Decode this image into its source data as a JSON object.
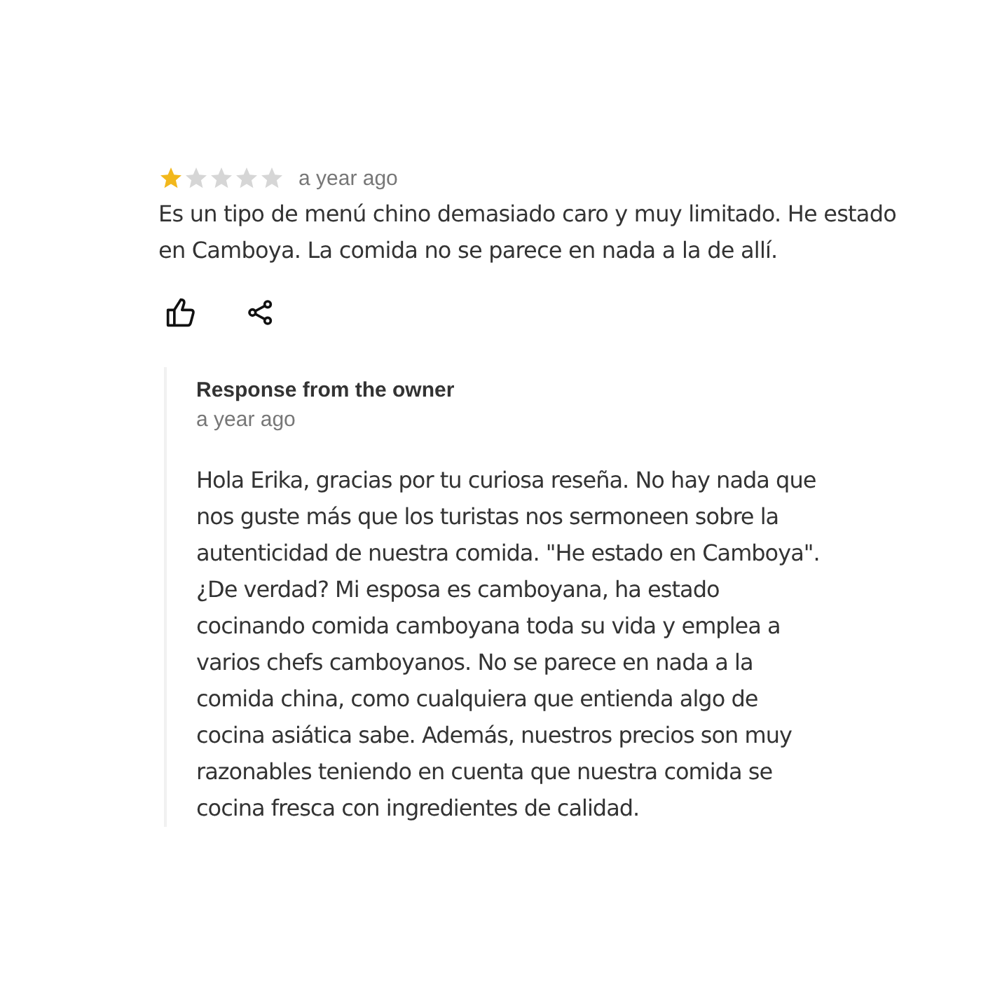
{
  "review": {
    "stars": 1,
    "time": "a year ago",
    "text": "Es un tipo de menú chino demasiado caro y muy limitado. He estado en Camboya. La comida no se parece en nada a la de allí."
  },
  "response": {
    "title": "Response from the owner",
    "time": "a year ago",
    "text": "Hola Erika, gracias por tu curiosa reseña. No hay nada que nos guste más que los turistas nos sermoneen sobre la autenticidad de nuestra comida. \"He estado en Camboya\". ¿De verdad? Mi esposa es camboyana, ha estado cocinando comida camboyana toda su vida y emplea a varios chefs camboyanos. No se parece en nada a la comida china, como cualquiera que entienda algo de cocina asiática sabe. Además, nuestros precios son muy razonables teniendo en cuenta que nuestra comida se cocina fresca con ingredientes de calidad."
  }
}
